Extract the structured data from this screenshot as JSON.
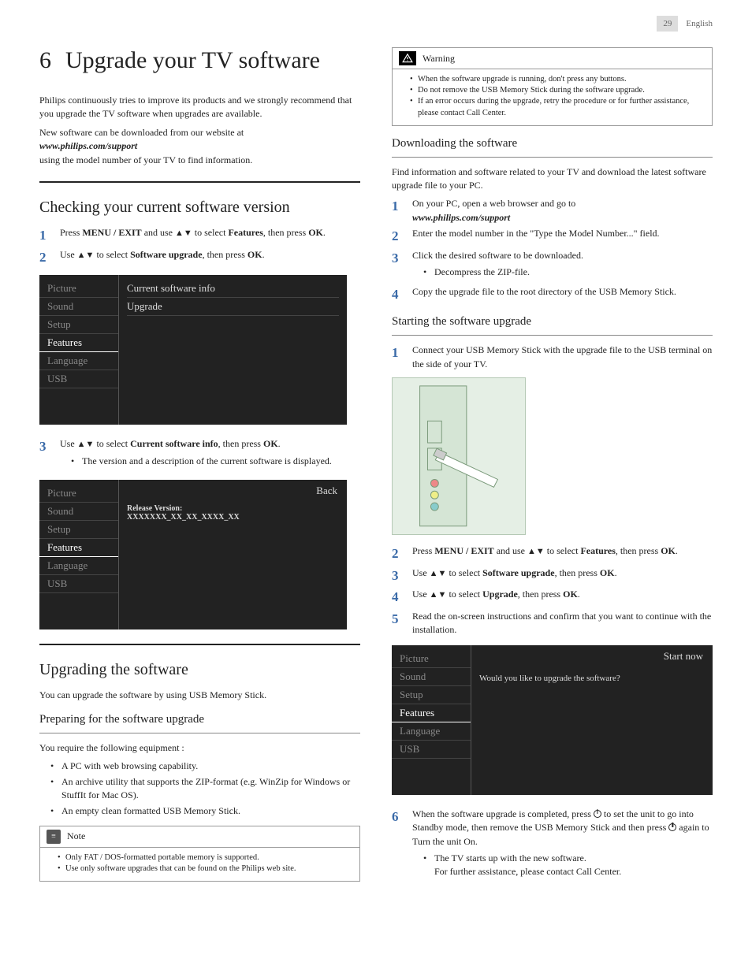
{
  "header": {
    "page_num": "29",
    "lang": "English"
  },
  "chapter": {
    "num": "6",
    "title": "Upgrade your TV software"
  },
  "intro": {
    "p1": "Philips continuously tries to improve its products and we strongly recommend that you upgrade the TV software when upgrades are available.",
    "p2_a": "New software can be downloaded from our website at",
    "p2_url": "www.philips.com/support",
    "p2_b": "using the model number of your TV to find information."
  },
  "checking": {
    "title": "Checking your current software version",
    "steps12": {
      "s1_a": "Press ",
      "s1_b": "MENU / EXIT",
      "s1_c": " and use ",
      "s1_d": " to select ",
      "s1_e": "Features",
      "s1_f": ", then press ",
      "s1_g": "OK",
      "s1_h": ".",
      "s2_a": "Use ",
      "s2_b": " to select ",
      "s2_c": "Software upgrade",
      "s2_d": ", then press ",
      "s2_e": "OK",
      "s2_f": "."
    },
    "menu1": {
      "left": [
        "Picture",
        "Sound",
        "Setup",
        "Features",
        "Language",
        "USB"
      ],
      "right": [
        "Current software info",
        "Upgrade"
      ]
    },
    "step3": {
      "a": "Use ",
      "b": " to select ",
      "c": "Current software info",
      "d": ", then press ",
      "e": "OK",
      "f": ".",
      "bullet": "The version and a description of the current software is displayed."
    },
    "menu2": {
      "back": "Back",
      "rel_label": "Release Version:",
      "rel_value": "XXXXXXX_XX_XX_XXXX_XX"
    }
  },
  "upgrading": {
    "title": "Upgrading the software",
    "intro": "You can upgrade the software by using USB Memory Stick.",
    "prep_title": "Preparing for the software upgrade",
    "prep_intro": "You require the following equipment :",
    "prep_items": [
      "A PC with web browsing capability.",
      "An archive utility that supports the ZIP-format (e.g. WinZip for Windows or StuffIt for Mac OS).",
      "An empty clean formatted USB Memory Stick."
    ],
    "note_label": "Note",
    "note_items": [
      "Only FAT / DOS-formatted portable memory is supported.",
      "Use only software upgrades that can be found on the Philips web site."
    ]
  },
  "warning": {
    "label": "Warning",
    "items": [
      "When the software upgrade is running, don't press any buttons.",
      "Do not remove the USB Memory Stick during the software upgrade.",
      "If an error occurs during the upgrade, retry the procedure or for further assistance, please contact Call Center."
    ]
  },
  "downloading": {
    "title": "Downloading the software",
    "intro": "Find information and software related to your TV and download the latest software upgrade file to your PC.",
    "s1_a": "On your PC, open a web browser and go to",
    "s1_url": "www.philips.com/support",
    "s2": "Enter the model number in the \"Type the Model Number...\" field.",
    "s3": "Click the desired software to be downloaded.",
    "s3_b": "Decompress the ZIP-file.",
    "s4": "Copy the upgrade file to the root directory of the USB Memory Stick."
  },
  "starting": {
    "title": "Starting the software upgrade",
    "s1": "Connect your USB Memory Stick with the upgrade file to the USB terminal on the side of your TV.",
    "s2_a": "Press ",
    "s2_b": "MENU / EXIT",
    "s2_c": " and use ",
    "s2_d": " to select ",
    "s2_e": "Features",
    "s2_f": ", then press ",
    "s2_g": "OK",
    "s2_h": ".",
    "s3_a": "Use ",
    "s3_b": " to select ",
    "s3_c": "Software upgrade",
    "s3_d": ", then press ",
    "s3_e": "OK",
    "s3_f": ".",
    "s4_a": "Use ",
    "s4_b": " to select ",
    "s4_c": "Upgrade",
    "s4_d": ", then press ",
    "s4_e": "OK",
    "s4_f": ".",
    "s5": "Read the on-screen instructions and confirm that you want to continue with the installation.",
    "menu3": {
      "start": "Start now",
      "msg": "Would you like to upgrade the software?"
    },
    "s6_a": "When the software upgrade is completed, press ",
    "s6_b": " to set the unit to go into Standby mode, then remove the USB Memory Stick and then press ",
    "s6_c": " again to Turn the unit On.",
    "s6_bul1": "The TV starts up with the new software.",
    "s6_bul2": "For further assistance, please contact Call Center."
  },
  "menu_items": [
    "Picture",
    "Sound",
    "Setup",
    "Features",
    "Language",
    "USB"
  ]
}
